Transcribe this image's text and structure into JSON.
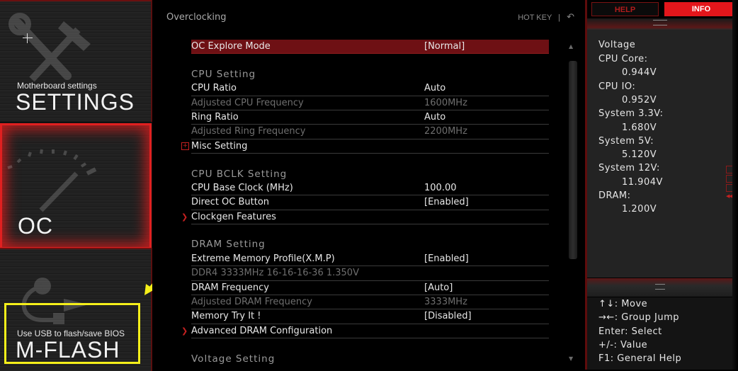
{
  "sidebar": {
    "tiles": [
      {
        "id": "settings",
        "subtitle": "Motherboard settings",
        "title": "SETTINGS",
        "icon": "wrench-hammer-icon",
        "active": false
      },
      {
        "id": "oc",
        "subtitle": "",
        "title": "OC",
        "icon": "gauge-icon",
        "active": true
      },
      {
        "id": "mflash",
        "subtitle": "Use USB to flash/save BIOS",
        "title": "M-FLASH",
        "icon": "usb-icon",
        "active": false
      }
    ]
  },
  "header": {
    "title": "Overclocking",
    "hotkey_label": "HOT KEY",
    "hotkey_sep": "|",
    "back_icon": "↶"
  },
  "settings_list": [
    {
      "type": "item",
      "label": "OC Explore Mode",
      "value": "[Normal]",
      "selected": true
    },
    {
      "type": "gap"
    },
    {
      "type": "header",
      "label": "CPU  Setting"
    },
    {
      "type": "item",
      "label": "CPU Ratio",
      "value": "Auto"
    },
    {
      "type": "dim",
      "label": "Adjusted CPU Frequency",
      "value": "1600MHz"
    },
    {
      "type": "item",
      "label": "Ring Ratio",
      "value": "Auto"
    },
    {
      "type": "dim",
      "label": "Adjusted Ring Frequency",
      "value": "2200MHz"
    },
    {
      "type": "item",
      "label": "Misc Setting",
      "value": "",
      "prefix": "plus"
    },
    {
      "type": "gap"
    },
    {
      "type": "header",
      "label": "CPU  BCLK  Setting"
    },
    {
      "type": "item",
      "label": "CPU Base Clock (MHz)",
      "value": "100.00"
    },
    {
      "type": "item",
      "label": "Direct OC Button",
      "value": "[Enabled]"
    },
    {
      "type": "item",
      "label": "Clockgen Features",
      "value": "",
      "prefix": "arrow"
    },
    {
      "type": "gap"
    },
    {
      "type": "header",
      "label": "DRAM  Setting"
    },
    {
      "type": "item",
      "label": "Extreme Memory Profile(X.M.P)",
      "value": "[Enabled]"
    },
    {
      "type": "dim",
      "label": "DDR4 3333MHz 16-16-16-36 1.350V",
      "value": ""
    },
    {
      "type": "item",
      "label": "DRAM Frequency",
      "value": "[Auto]"
    },
    {
      "type": "dim",
      "label": "Adjusted DRAM Frequency",
      "value": "3333MHz"
    },
    {
      "type": "item",
      "label": "Memory Try It !",
      "value": "[Disabled]"
    },
    {
      "type": "item",
      "label": "Advanced DRAM Configuration",
      "value": "",
      "prefix": "arrow"
    },
    {
      "type": "gap"
    },
    {
      "type": "header",
      "label": "Voltage  Setting"
    }
  ],
  "right_panel": {
    "tabs": [
      {
        "label": "HELP",
        "active": false
      },
      {
        "label": "INFO",
        "active": true
      }
    ],
    "info_title": "Voltage",
    "voltages": [
      {
        "label": "CPU  Core:",
        "value": "0.944V"
      },
      {
        "label": "CPU  IO:",
        "value": "0.952V"
      },
      {
        "label": "System  3.3V:",
        "value": "1.680V"
      },
      {
        "label": "System  5V:",
        "value": "5.120V"
      },
      {
        "label": "System  12V:",
        "value": "11.904V"
      },
      {
        "label": "DRAM:",
        "value": "1.200V"
      }
    ],
    "key_help": [
      "↑↓: Move",
      "→←: Group  Jump",
      "Enter: Select",
      "+/-: Value",
      "F1: General  Help"
    ]
  },
  "annotation": {
    "highlight_color": "#f5ef1a",
    "target": "mflash"
  },
  "colors": {
    "accent_red": "#e3161b",
    "selected_row": "#6e1014"
  }
}
